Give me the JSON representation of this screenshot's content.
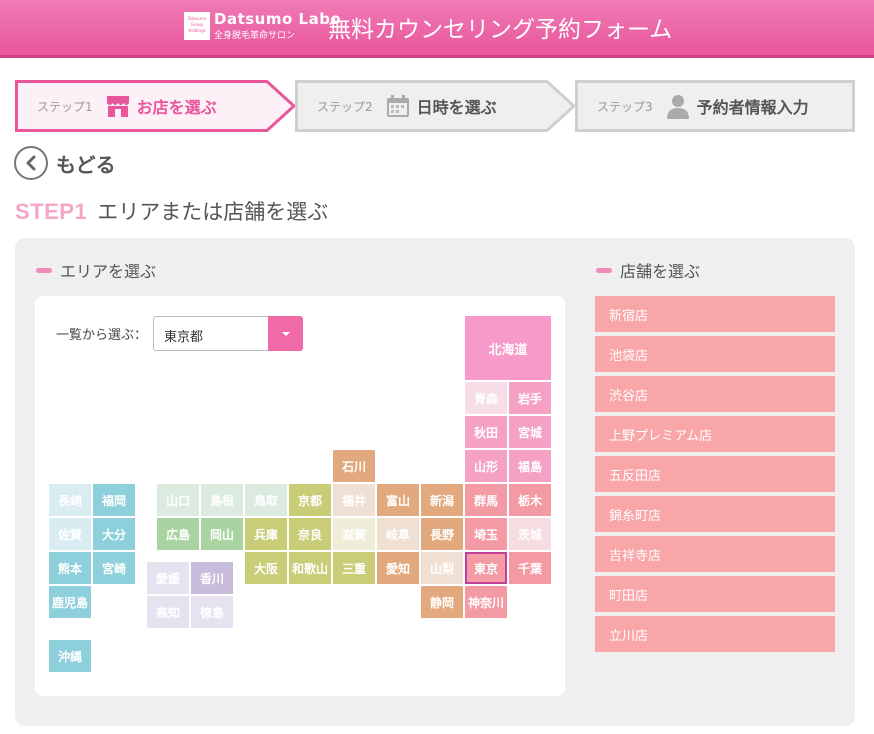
{
  "colors": {
    "accent": "#e8569c",
    "store_bg": "#f9a6a8"
  },
  "header": {
    "logo_mark": "Datsumo Group Holdings",
    "logo_en": "Datsumo Labo",
    "logo_ja": "全身脱毛革命サロン",
    "title": "無料カウンセリング予約フォーム"
  },
  "steps": [
    {
      "num": "ステップ1",
      "label": "お店を選ぶ",
      "icon": "shop-icon",
      "active": true
    },
    {
      "num": "ステップ2",
      "label": "日時を選ぶ",
      "icon": "calendar-icon",
      "active": false
    },
    {
      "num": "ステップ3",
      "label": "予約者情報入力",
      "icon": "person-icon",
      "active": false
    }
  ],
  "back_label": "もどる",
  "heading": {
    "step": "STEP1",
    "text": "エリアまたは店舗を選ぶ"
  },
  "area": {
    "title": "エリアを選ぶ",
    "list_label": "一覧から選ぶ：",
    "select_value": "東京都",
    "prefectures": [
      {
        "name": "北海道",
        "color": "#f799c9"
      },
      {
        "name": "青森",
        "color": "#f6dde8"
      },
      {
        "name": "岩手",
        "color": "#f4a1c4"
      },
      {
        "name": "秋田",
        "color": "#f4a1c4"
      },
      {
        "name": "宮城",
        "color": "#f4a1c4"
      },
      {
        "name": "山形",
        "color": "#f4a1c4"
      },
      {
        "name": "福島",
        "color": "#f4a1c4"
      },
      {
        "name": "群馬",
        "color": "#f49aa4"
      },
      {
        "name": "栃木",
        "color": "#f49aa4"
      },
      {
        "name": "埼玉",
        "color": "#f49aa4"
      },
      {
        "name": "茨城",
        "color": "#f6dde2"
      },
      {
        "name": "東京",
        "color": "#f49aa4",
        "selected": true
      },
      {
        "name": "千葉",
        "color": "#f49aa4"
      },
      {
        "name": "神奈川",
        "color": "#f49aa4"
      },
      {
        "name": "石川",
        "color": "#e3a97e"
      },
      {
        "name": "富山",
        "color": "#e3a97e"
      },
      {
        "name": "新潟",
        "color": "#e3a97e"
      },
      {
        "name": "福井",
        "color": "#f0e0d4"
      },
      {
        "name": "岐阜",
        "color": "#f0e0d4"
      },
      {
        "name": "長野",
        "color": "#e3a97e"
      },
      {
        "name": "愛知",
        "color": "#e3a97e"
      },
      {
        "name": "山梨",
        "color": "#f0e0d4"
      },
      {
        "name": "静岡",
        "color": "#e3a97e"
      },
      {
        "name": "京都",
        "color": "#c9cd78"
      },
      {
        "name": "滋賀",
        "color": "#eeeed8"
      },
      {
        "name": "兵庫",
        "color": "#c9cd78"
      },
      {
        "name": "奈良",
        "color": "#c9cd78"
      },
      {
        "name": "大阪",
        "color": "#c9cd78"
      },
      {
        "name": "和歌山",
        "color": "#c9cd78"
      },
      {
        "name": "三重",
        "color": "#c9cd78"
      },
      {
        "name": "山口",
        "color": "#dcebdf"
      },
      {
        "name": "島根",
        "color": "#dcebdf"
      },
      {
        "name": "鳥取",
        "color": "#dcebdf"
      },
      {
        "name": "広島",
        "color": "#a9d3a0"
      },
      {
        "name": "岡山",
        "color": "#a9d3a0"
      },
      {
        "name": "愛媛",
        "color": "#e6e2ef"
      },
      {
        "name": "香川",
        "color": "#c7bcda"
      },
      {
        "name": "高知",
        "color": "#e6e2ef"
      },
      {
        "name": "徳島",
        "color": "#e6e2ef"
      },
      {
        "name": "長崎",
        "color": "#d9ecf2"
      },
      {
        "name": "福岡",
        "color": "#8dcfdb"
      },
      {
        "name": "佐賀",
        "color": "#d9ecf2"
      },
      {
        "name": "大分",
        "color": "#8dcfdb"
      },
      {
        "name": "熊本",
        "color": "#8dcfdb"
      },
      {
        "name": "宮崎",
        "color": "#8dcfdb"
      },
      {
        "name": "鹿児島",
        "color": "#8dcfdb"
      },
      {
        "name": "沖縄",
        "color": "#8dcfdb"
      }
    ]
  },
  "stores": {
    "title": "店舗を選ぶ",
    "items": [
      "新宿店",
      "池袋店",
      "渋谷店",
      "上野プレミアム店",
      "五反田店",
      "錦糸町店",
      "吉祥寺店",
      "町田店",
      "立川店"
    ]
  }
}
